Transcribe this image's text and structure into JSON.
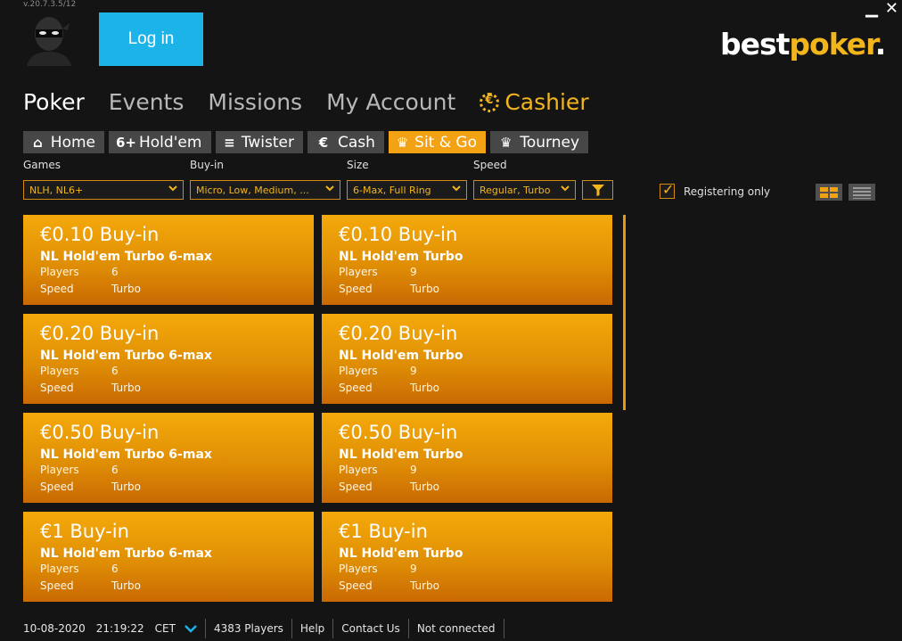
{
  "app": {
    "version": "v.20.7.3.5/12",
    "login_label": "Log in",
    "logo": {
      "part1": "best",
      "part2": "poker",
      "part3": "."
    },
    "colors": {
      "accent": "#f3b51c",
      "tile": "#e39307",
      "login": "#1cb4e8",
      "background": "#141414"
    }
  },
  "main_nav": [
    {
      "label": "Poker"
    },
    {
      "label": "Events"
    },
    {
      "label": "Missions"
    },
    {
      "label": "My Account"
    },
    {
      "label": "Cashier",
      "icon": "euro-coin-icon"
    }
  ],
  "sub_tabs": [
    {
      "label": "Home",
      "icon": "house-icon",
      "glyph": "⌂"
    },
    {
      "label": "Hold'em",
      "icon": "six-plus-icon",
      "glyph": "6+"
    },
    {
      "label": "Twister",
      "icon": "twister-icon",
      "glyph": "≡"
    },
    {
      "label": "Cash",
      "icon": "euro-icon",
      "glyph": "€"
    },
    {
      "label": "Sit & Go",
      "icon": "trophy-icon",
      "glyph": "♛"
    },
    {
      "label": "Tourney",
      "icon": "cup-icon",
      "glyph": "♛"
    }
  ],
  "filters": {
    "games": {
      "label": "Games",
      "value": "NLH, NL6+"
    },
    "buyin": {
      "label": "Buy-in",
      "value": "Micro, Low, Medium, ..."
    },
    "size": {
      "label": "Size",
      "value": "6-Max, Full Ring"
    },
    "speed": {
      "label": "Speed",
      "value": "Regular, Turbo"
    }
  },
  "registering_only": {
    "label": "Registering only",
    "checked": true
  },
  "tile_labels": {
    "players": "Players",
    "speed": "Speed"
  },
  "tiles": [
    {
      "buyin": "€0.10 Buy-in",
      "game": "NL Hold'em  Turbo 6-max",
      "players": "6",
      "speed": "Turbo"
    },
    {
      "buyin": "€0.10 Buy-in",
      "game": "NL Hold'em  Turbo",
      "players": "9",
      "speed": "Turbo"
    },
    {
      "buyin": "€0.20 Buy-in",
      "game": "NL Hold'em  Turbo 6-max",
      "players": "6",
      "speed": "Turbo"
    },
    {
      "buyin": "€0.20 Buy-in",
      "game": "NL Hold'em  Turbo",
      "players": "9",
      "speed": "Turbo"
    },
    {
      "buyin": "€0.50 Buy-in",
      "game": "NL Hold'em  Turbo 6-max",
      "players": "6",
      "speed": "Turbo"
    },
    {
      "buyin": "€0.50 Buy-in",
      "game": "NL Hold'em  Turbo",
      "players": "9",
      "speed": "Turbo"
    },
    {
      "buyin": "€1 Buy-in",
      "game": "NL Hold'em  Turbo 6-max",
      "players": "6",
      "speed": "Turbo"
    },
    {
      "buyin": "€1 Buy-in",
      "game": "NL Hold'em  Turbo",
      "players": "9",
      "speed": "Turbo"
    }
  ],
  "status": {
    "date": "10-08-2020",
    "time": "21:19:22",
    "tz": "CET",
    "players": "4383 Players",
    "help": "Help",
    "contact": "Contact Us",
    "connection": "Not connected"
  }
}
